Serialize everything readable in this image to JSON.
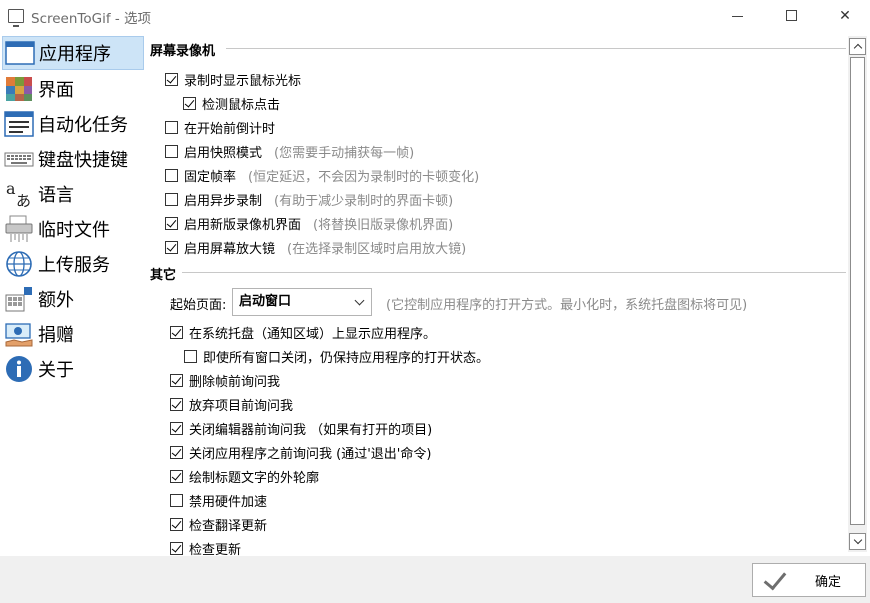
{
  "window": {
    "title": "ScreenToGif - 选项"
  },
  "sidebar": {
    "items": [
      {
        "label": "应用程序",
        "icon": "window-icon",
        "selected": true
      },
      {
        "label": "界面",
        "icon": "palette-icon",
        "selected": false
      },
      {
        "label": "自动化任务",
        "icon": "task-list-icon",
        "selected": false
      },
      {
        "label": "键盘快捷键",
        "icon": "keyboard-icon",
        "selected": false
      },
      {
        "label": "语言",
        "icon": "language-icon",
        "selected": false
      },
      {
        "label": "临时文件",
        "icon": "shredder-icon",
        "selected": false
      },
      {
        "label": "上传服务",
        "icon": "globe-icon",
        "selected": false
      },
      {
        "label": "额外",
        "icon": "extras-icon",
        "selected": false
      },
      {
        "label": "捐赠",
        "icon": "donate-icon",
        "selected": false
      },
      {
        "label": "关于",
        "icon": "info-icon",
        "selected": false
      }
    ]
  },
  "recorder": {
    "header": "屏幕录像机",
    "options": [
      {
        "label": "录制时显示鼠标光标",
        "hint": "",
        "checked": true,
        "indent": 0
      },
      {
        "label": "检测鼠标点击",
        "hint": "",
        "checked": true,
        "indent": 1
      },
      {
        "label": "在开始前倒计时",
        "hint": "",
        "checked": false,
        "indent": 0
      },
      {
        "label": "启用快照模式",
        "hint": "(您需要手动捕获每一帧)",
        "checked": false,
        "indent": 0
      },
      {
        "label": "固定帧率",
        "hint": "(恒定延迟，不会因为录制时的卡顿变化)",
        "checked": false,
        "indent": 0
      },
      {
        "label": "启用异步录制",
        "hint": "(有助于减少录制时的界面卡顿)",
        "checked": false,
        "indent": 0
      },
      {
        "label": "启用新版录像机界面",
        "hint": "(将替换旧版录像机界面)",
        "checked": true,
        "indent": 0
      },
      {
        "label": "启用屏幕放大镜",
        "hint": "(在选择录制区域时启用放大镜)",
        "checked": true,
        "indent": 0
      }
    ]
  },
  "other": {
    "header": "其它",
    "start_page_label": "起始页面:",
    "start_page_value": "启动窗口",
    "start_page_hint": "(它控制应用程序的打开方式。最小化时，系统托盘图标将可见)",
    "options": [
      {
        "label": "在系统托盘（通知区域）上显示应用程序。",
        "hint": "",
        "checked": true,
        "indent": 0
      },
      {
        "label": "即使所有窗口关闭，仍保持应用程序的打开状态。",
        "hint": "",
        "checked": false,
        "indent": 1
      },
      {
        "label": "删除帧前询问我",
        "hint": "",
        "checked": true,
        "indent": 0
      },
      {
        "label": "放弃项目前询问我",
        "hint": "",
        "checked": true,
        "indent": 0
      },
      {
        "label": "关闭编辑器前询问我 （如果有打开的项目)",
        "hint": "",
        "checked": true,
        "indent": 0
      },
      {
        "label": "关闭应用程序之前询问我 (通过'退出'命令)",
        "hint": "",
        "checked": true,
        "indent": 0
      },
      {
        "label": "绘制标题文字的外轮廓",
        "hint": "",
        "checked": true,
        "indent": 0
      },
      {
        "label": "禁用硬件加速",
        "hint": "",
        "checked": false,
        "indent": 0
      },
      {
        "label": "检查翻译更新",
        "hint": "",
        "checked": true,
        "indent": 0
      },
      {
        "label": "检查更新",
        "hint": "",
        "checked": true,
        "indent": 0
      }
    ]
  },
  "footer": {
    "ok_label": "确定"
  }
}
